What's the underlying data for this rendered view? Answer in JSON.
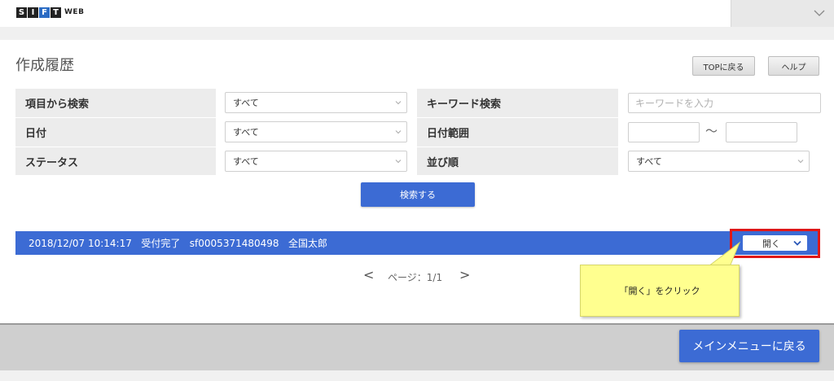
{
  "header": {
    "logo_letters": [
      "S",
      "I",
      "F",
      "T"
    ],
    "logo_suffix": "WEB",
    "menu_icon": "chevron-down-icon"
  },
  "page": {
    "title": "作成履歴",
    "top_button": "TOPに戻る",
    "help_button": "ヘルプ"
  },
  "search": {
    "item_label": "項目から検索",
    "item_value": "すべて",
    "date_label": "日付",
    "date_value": "すべて",
    "status_label": "ステータス",
    "status_value": "すべて",
    "keyword_label": "キーワード検索",
    "keyword_placeholder": "キーワードを入力",
    "range_label": "日付範囲",
    "range_separator": "～",
    "sort_label": "並び順",
    "sort_value": "すべて",
    "submit_label": "検索する"
  },
  "results": [
    {
      "datetime": "2018/12/07 10:14:17",
      "status": "受付完了",
      "id": "sf0005371480498",
      "name": "全国太郎",
      "action_label": "開く"
    }
  ],
  "pager": {
    "prev": "<",
    "text": "ページ：1/1",
    "next": ">"
  },
  "callout": {
    "text": "「開く」をクリック"
  },
  "footer": {
    "main_menu_button": "メインメニューに戻る"
  },
  "colors": {
    "accent_blue": "#3c6bd4",
    "highlight_red": "#e01818",
    "callout_yellow": "#ffff8f"
  }
}
